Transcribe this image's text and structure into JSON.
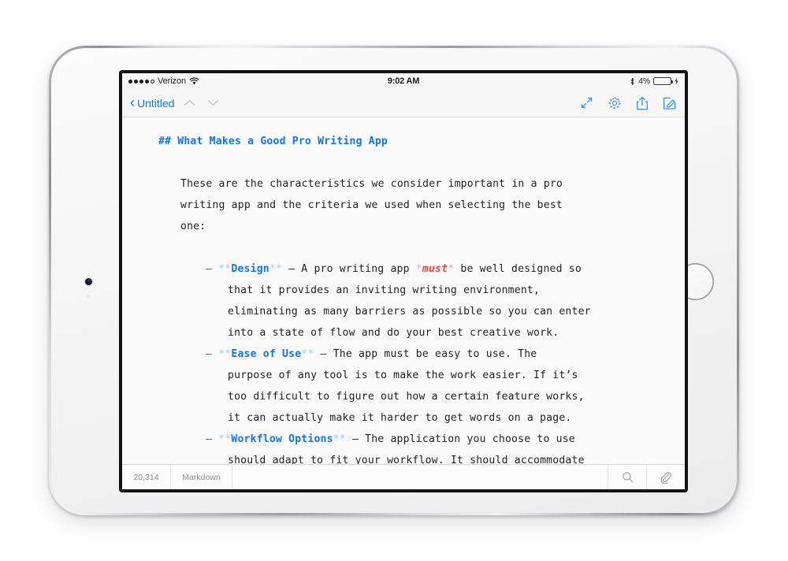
{
  "status_bar": {
    "carrier": "Verizon",
    "signal_filled": 4,
    "signal_total": 5,
    "wifi_icon": "wifi-icon",
    "time": "9:02 AM",
    "bluetooth_icon": "bluetooth-icon",
    "battery_percent": "4%",
    "battery_level": 4,
    "battery_color": "#e8453c",
    "charging_icon": "lightning-bolt-icon"
  },
  "nav_bar": {
    "back_label": "Untitled",
    "back_icon": "chevron-left-icon",
    "prev_icon": "chevron-up-icon",
    "next_icon": "chevron-down-icon",
    "expand_icon": "expand-arrows-icon",
    "settings_icon": "gear-icon",
    "share_icon": "share-icon",
    "compose_icon": "compose-icon",
    "accent_color": "#0b7bf1"
  },
  "document": {
    "heading": {
      "marker": "## ",
      "text": "What Makes a Good Pro Writing App"
    },
    "intro_lines": [
      "These are the characteristics we consider important in a pro",
      "writing app and the criteria we used when selecting the best",
      "one:"
    ],
    "bullets": [
      {
        "dash": "–",
        "mark": "**",
        "term": "Design",
        "separator": " – ",
        "first_line_pre": "A pro writing app ",
        "italic_mark": "*",
        "italic_text": "must",
        "first_line_post": " be well designed so",
        "continuation": [
          "that it provides an inviting writing environment,",
          "eliminating as many barriers as possible so you can enter",
          "into a state of flow and do your best creative work."
        ]
      },
      {
        "dash": "–",
        "mark": "**",
        "term": "Ease of Use",
        "separator": " – ",
        "first_line_pre": "The app must be easy to use. The",
        "continuation": [
          "purpose of any tool is to make the work easier. If it’s",
          "too difficult to figure out how a certain feature works,",
          "it can actually make it harder to get words on a page."
        ]
      },
      {
        "dash": "–",
        "mark": "**",
        "term": "Workflow Options",
        "separator": " – ",
        "first_line_pre": "The application you choose to use",
        "continuation": [
          "should adapt to fit your workflow. It should accommodate"
        ]
      }
    ],
    "colors": {
      "heading": "#1273f0",
      "strong": "#1273f0",
      "emphasis_marker": "#9ecbfa",
      "italic": "#e8453c",
      "italic_marker": "#f3a9a3",
      "body": "#222222"
    }
  },
  "bottom_bar": {
    "word_count": "20,314",
    "format": "Markdown",
    "search_icon": "search-icon",
    "attach_icon": "paperclip-icon"
  }
}
